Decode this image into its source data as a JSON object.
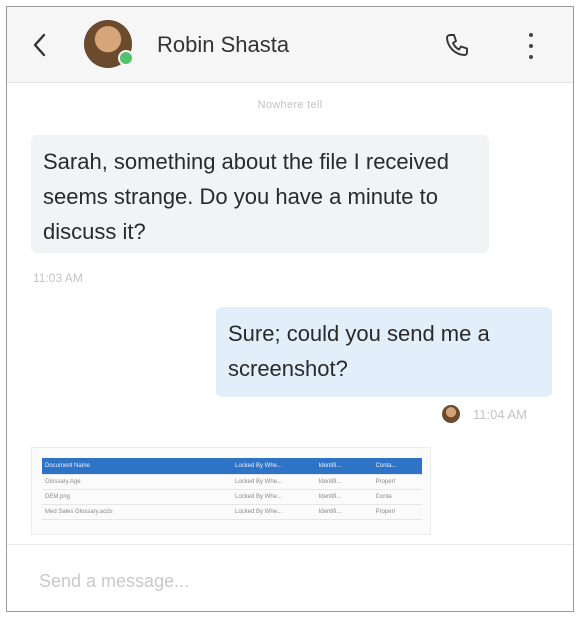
{
  "header": {
    "contact_name": "Robin Shasta",
    "back_icon": "chevron-left-icon",
    "call_icon": "phone-icon",
    "more_icon": "kebab-menu-icon",
    "presence_color": "#55c26b"
  },
  "conversation": {
    "reader_note": "Nowhere tell",
    "messages": [
      {
        "direction": "incoming",
        "text": "Sarah, something about the file I received seems strange. Do you have a minute to discuss it?",
        "time": "11:03 AM"
      },
      {
        "direction": "outgoing",
        "text": "Sure; could you send me a screenshot?",
        "time": "11:04 AM"
      }
    ],
    "attachment_table": {
      "headers": [
        "Document Name",
        "Locked By Whe...",
        "Identifi...",
        "Conta..."
      ],
      "rows": [
        [
          "Glossary.Age",
          "Locked By Whe...",
          "Identifi...",
          "Properl"
        ],
        [
          "DEM.png",
          "Locked By Whe...",
          "Identifi...",
          "Conta"
        ],
        [
          "Med Sales Glossary.acds",
          "Locked By Whe...",
          "Identifi...",
          "Properl"
        ]
      ]
    }
  },
  "composer": {
    "placeholder": "Send a message..."
  },
  "colors": {
    "incoming_bubble": "#f2f3f5",
    "outgoing_bubble": "#e2eef9",
    "table_header": "#2f73c6"
  }
}
